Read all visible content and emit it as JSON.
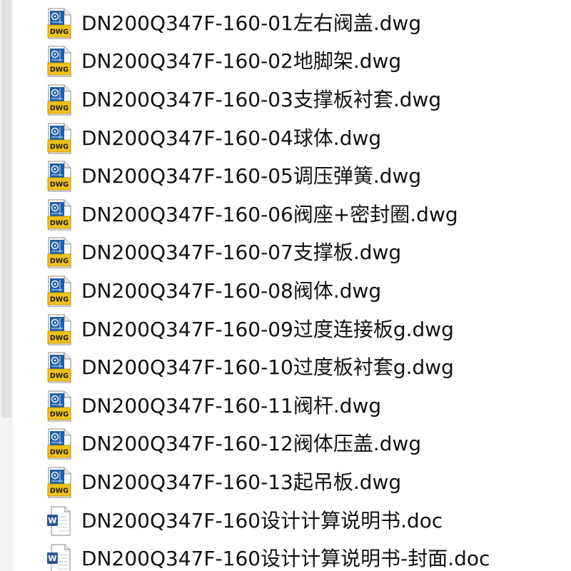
{
  "files": [
    {
      "name": "DN200Q347F-160-01左右阀盖.dwg",
      "icon": "dwg-file-icon",
      "type": "dwg"
    },
    {
      "name": "DN200Q347F-160-02地脚架.dwg",
      "icon": "dwg-file-icon",
      "type": "dwg"
    },
    {
      "name": "DN200Q347F-160-03支撑板衬套.dwg",
      "icon": "dwg-file-icon",
      "type": "dwg"
    },
    {
      "name": "DN200Q347F-160-04球体.dwg",
      "icon": "dwg-file-icon",
      "type": "dwg"
    },
    {
      "name": "DN200Q347F-160-05调压弹簧.dwg",
      "icon": "dwg-file-icon",
      "type": "dwg"
    },
    {
      "name": "DN200Q347F-160-06阀座+密封圈.dwg",
      "icon": "dwg-file-icon",
      "type": "dwg"
    },
    {
      "name": "DN200Q347F-160-07支撑板.dwg",
      "icon": "dwg-file-icon",
      "type": "dwg"
    },
    {
      "name": "DN200Q347F-160-08阀体.dwg",
      "icon": "dwg-file-icon",
      "type": "dwg"
    },
    {
      "name": "DN200Q347F-160-09过度连接板g.dwg",
      "icon": "dwg-file-icon",
      "type": "dwg"
    },
    {
      "name": "DN200Q347F-160-10过度板衬套g.dwg",
      "icon": "dwg-file-icon",
      "type": "dwg"
    },
    {
      "name": "DN200Q347F-160-11阀杆.dwg",
      "icon": "dwg-file-icon",
      "type": "dwg"
    },
    {
      "name": "DN200Q347F-160-12阀体压盖.dwg",
      "icon": "dwg-file-icon",
      "type": "dwg"
    },
    {
      "name": "DN200Q347F-160-13起吊板.dwg",
      "icon": "dwg-file-icon",
      "type": "dwg"
    },
    {
      "name": "DN200Q347F-160设计计算说明书.doc",
      "icon": "word-doc-icon",
      "type": "doc"
    },
    {
      "name": "DN200Q347F-160设计计算说明书-封面.doc",
      "icon": "word-doc-icon",
      "type": "doc"
    }
  ],
  "icon_labels": {
    "dwg": "DWG",
    "doc": "W"
  },
  "colors": {
    "dwg_yellow": "#f2c21a",
    "dwg_blue": "#1f5fa8",
    "doc_blue": "#2b5797",
    "scrollbar_track": "#f3f3f3",
    "scrollbar_thumb": "#e1e1e1",
    "text": "#111111"
  }
}
